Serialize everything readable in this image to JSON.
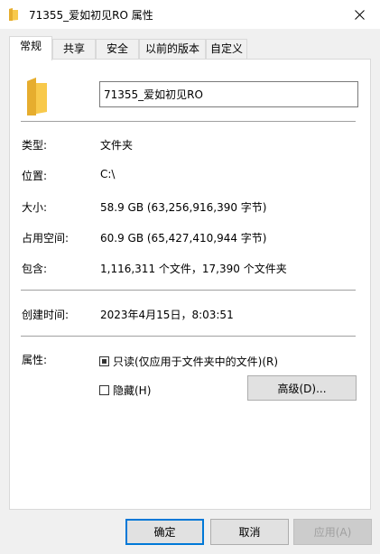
{
  "window": {
    "title": "71355_爱如初见RO 属性",
    "close_label": "✕"
  },
  "colors": {
    "folder_yellow": "#f8c94b",
    "folder_shade": "#e6ad2e",
    "accent": "#0078d7"
  },
  "tabs": [
    {
      "label": "常规",
      "active": true
    },
    {
      "label": "共享",
      "active": false
    },
    {
      "label": "安全",
      "active": false
    },
    {
      "label": "以前的版本",
      "active": false
    },
    {
      "label": "自定义",
      "active": false
    }
  ],
  "general": {
    "name": "71355_爱如初见RO",
    "rows": [
      {
        "label": "类型:",
        "value": "文件夹"
      },
      {
        "label": "位置:",
        "value": "C:\\"
      },
      {
        "label": "大小:",
        "value": "58.9 GB (63,256,916,390 字节)"
      },
      {
        "label": "占用空间:",
        "value": "60.9 GB (65,427,410,944 字节)"
      },
      {
        "label": "包含:",
        "value": "1,116,311 个文件，17,390 个文件夹"
      }
    ],
    "created": {
      "label": "创建时间:",
      "value": "2023年4月15日，8:03:51"
    },
    "attributes": {
      "label": "属性:",
      "readonly_label": "只读(仅应用于文件夹中的文件)(R)",
      "hidden_label": "隐藏(H)",
      "advanced_label": "高级(D)..."
    }
  },
  "buttons": {
    "ok": "确定",
    "cancel": "取消",
    "apply": "应用(A)"
  }
}
